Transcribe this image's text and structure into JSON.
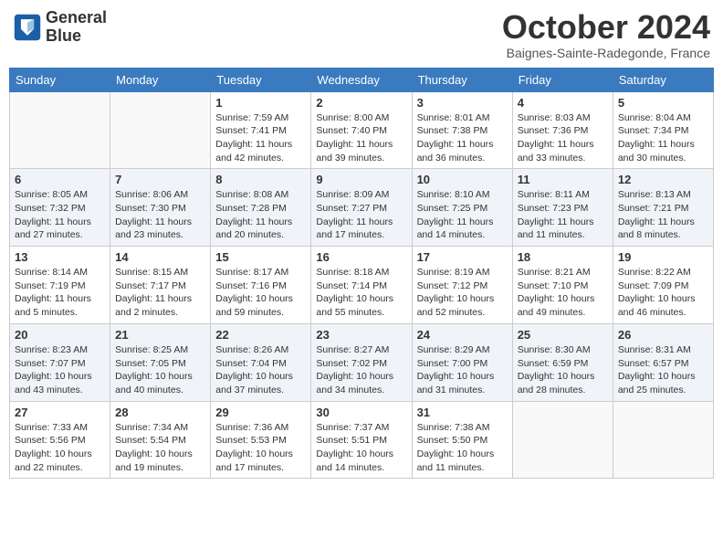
{
  "logo": {
    "line1": "General",
    "line2": "Blue"
  },
  "title": "October 2024",
  "location": "Baignes-Sainte-Radegonde, France",
  "headers": [
    "Sunday",
    "Monday",
    "Tuesday",
    "Wednesday",
    "Thursday",
    "Friday",
    "Saturday"
  ],
  "weeks": [
    [
      {
        "day": "",
        "content": ""
      },
      {
        "day": "",
        "content": ""
      },
      {
        "day": "1",
        "content": "Sunrise: 7:59 AM\nSunset: 7:41 PM\nDaylight: 11 hours and 42 minutes."
      },
      {
        "day": "2",
        "content": "Sunrise: 8:00 AM\nSunset: 7:40 PM\nDaylight: 11 hours and 39 minutes."
      },
      {
        "day": "3",
        "content": "Sunrise: 8:01 AM\nSunset: 7:38 PM\nDaylight: 11 hours and 36 minutes."
      },
      {
        "day": "4",
        "content": "Sunrise: 8:03 AM\nSunset: 7:36 PM\nDaylight: 11 hours and 33 minutes."
      },
      {
        "day": "5",
        "content": "Sunrise: 8:04 AM\nSunset: 7:34 PM\nDaylight: 11 hours and 30 minutes."
      }
    ],
    [
      {
        "day": "6",
        "content": "Sunrise: 8:05 AM\nSunset: 7:32 PM\nDaylight: 11 hours and 27 minutes."
      },
      {
        "day": "7",
        "content": "Sunrise: 8:06 AM\nSunset: 7:30 PM\nDaylight: 11 hours and 23 minutes."
      },
      {
        "day": "8",
        "content": "Sunrise: 8:08 AM\nSunset: 7:28 PM\nDaylight: 11 hours and 20 minutes."
      },
      {
        "day": "9",
        "content": "Sunrise: 8:09 AM\nSunset: 7:27 PM\nDaylight: 11 hours and 17 minutes."
      },
      {
        "day": "10",
        "content": "Sunrise: 8:10 AM\nSunset: 7:25 PM\nDaylight: 11 hours and 14 minutes."
      },
      {
        "day": "11",
        "content": "Sunrise: 8:11 AM\nSunset: 7:23 PM\nDaylight: 11 hours and 11 minutes."
      },
      {
        "day": "12",
        "content": "Sunrise: 8:13 AM\nSunset: 7:21 PM\nDaylight: 11 hours and 8 minutes."
      }
    ],
    [
      {
        "day": "13",
        "content": "Sunrise: 8:14 AM\nSunset: 7:19 PM\nDaylight: 11 hours and 5 minutes."
      },
      {
        "day": "14",
        "content": "Sunrise: 8:15 AM\nSunset: 7:17 PM\nDaylight: 11 hours and 2 minutes."
      },
      {
        "day": "15",
        "content": "Sunrise: 8:17 AM\nSunset: 7:16 PM\nDaylight: 10 hours and 59 minutes."
      },
      {
        "day": "16",
        "content": "Sunrise: 8:18 AM\nSunset: 7:14 PM\nDaylight: 10 hours and 55 minutes."
      },
      {
        "day": "17",
        "content": "Sunrise: 8:19 AM\nSunset: 7:12 PM\nDaylight: 10 hours and 52 minutes."
      },
      {
        "day": "18",
        "content": "Sunrise: 8:21 AM\nSunset: 7:10 PM\nDaylight: 10 hours and 49 minutes."
      },
      {
        "day": "19",
        "content": "Sunrise: 8:22 AM\nSunset: 7:09 PM\nDaylight: 10 hours and 46 minutes."
      }
    ],
    [
      {
        "day": "20",
        "content": "Sunrise: 8:23 AM\nSunset: 7:07 PM\nDaylight: 10 hours and 43 minutes."
      },
      {
        "day": "21",
        "content": "Sunrise: 8:25 AM\nSunset: 7:05 PM\nDaylight: 10 hours and 40 minutes."
      },
      {
        "day": "22",
        "content": "Sunrise: 8:26 AM\nSunset: 7:04 PM\nDaylight: 10 hours and 37 minutes."
      },
      {
        "day": "23",
        "content": "Sunrise: 8:27 AM\nSunset: 7:02 PM\nDaylight: 10 hours and 34 minutes."
      },
      {
        "day": "24",
        "content": "Sunrise: 8:29 AM\nSunset: 7:00 PM\nDaylight: 10 hours and 31 minutes."
      },
      {
        "day": "25",
        "content": "Sunrise: 8:30 AM\nSunset: 6:59 PM\nDaylight: 10 hours and 28 minutes."
      },
      {
        "day": "26",
        "content": "Sunrise: 8:31 AM\nSunset: 6:57 PM\nDaylight: 10 hours and 25 minutes."
      }
    ],
    [
      {
        "day": "27",
        "content": "Sunrise: 7:33 AM\nSunset: 5:56 PM\nDaylight: 10 hours and 22 minutes."
      },
      {
        "day": "28",
        "content": "Sunrise: 7:34 AM\nSunset: 5:54 PM\nDaylight: 10 hours and 19 minutes."
      },
      {
        "day": "29",
        "content": "Sunrise: 7:36 AM\nSunset: 5:53 PM\nDaylight: 10 hours and 17 minutes."
      },
      {
        "day": "30",
        "content": "Sunrise: 7:37 AM\nSunset: 5:51 PM\nDaylight: 10 hours and 14 minutes."
      },
      {
        "day": "31",
        "content": "Sunrise: 7:38 AM\nSunset: 5:50 PM\nDaylight: 10 hours and 11 minutes."
      },
      {
        "day": "",
        "content": ""
      },
      {
        "day": "",
        "content": ""
      }
    ]
  ]
}
